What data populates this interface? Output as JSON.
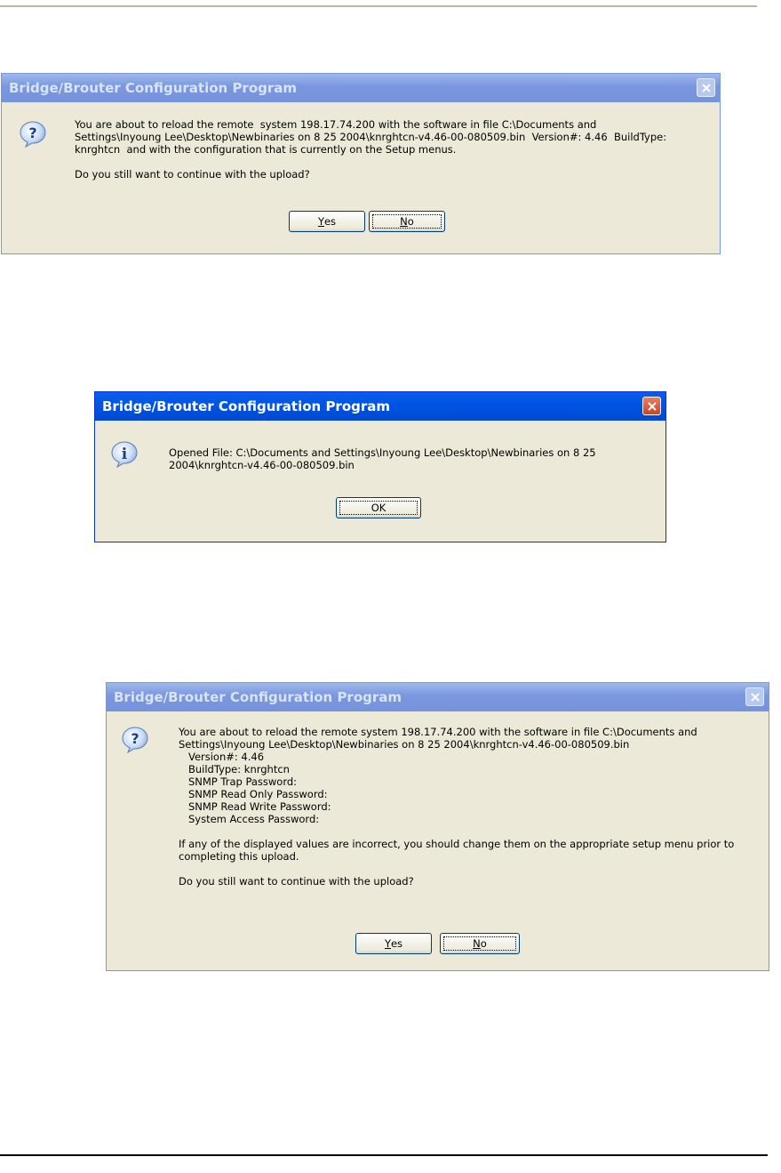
{
  "dialogs": [
    {
      "title": "Bridge/Brouter Configuration Program",
      "icon": "question-icon",
      "message": "You are about to reload the remote  system 198.17.74.200 with the software in file C:\\Documents and\nSettings\\Inyoung Lee\\Desktop\\Newbinaries on 8 25 2004\\knrghtcn-v4.46-00-080509.bin  Version#: 4.46  BuildType:\nknrghtcn  and with the configuration that is currently on the Setup menus.\n\nDo you still want to continue with the upload?",
      "buttons": {
        "yes": {
          "mnemonic": "Y",
          "rest": "es"
        },
        "no": {
          "mnemonic": "N",
          "rest": "o"
        }
      }
    },
    {
      "title": "Bridge/Brouter Configuration Program",
      "icon": "info-icon",
      "message": "Opened File: C:\\Documents and Settings\\Inyoung Lee\\Desktop\\Newbinaries on 8 25\n2004\\knrghtcn-v4.46-00-080509.bin",
      "buttons": {
        "ok": "OK"
      }
    },
    {
      "title": "Bridge/Brouter Configuration Program",
      "icon": "question-icon",
      "message": "You are about to reload the remote system 198.17.74.200 with the software in file C:\\Documents and\nSettings\\Inyoung Lee\\Desktop\\Newbinaries on 8 25 2004\\knrghtcn-v4.46-00-080509.bin\n   Version#: 4.46\n   BuildType: knrghtcn\n   SNMP Trap Password:\n   SNMP Read Only Password:\n   SNMP Read Write Password:\n   System Access Password:\n\nIf any of the displayed values are incorrect, you should change them on the appropriate setup menu prior to\ncompleting this upload.\n\nDo you still want to continue with the upload?",
      "buttons": {
        "yes": {
          "mnemonic": "Y",
          "rest": "es"
        },
        "no": {
          "mnemonic": "N",
          "rest": "o"
        }
      }
    }
  ],
  "colors": {
    "dialog_bg": "#ece9d8",
    "active_title": "#0055e5",
    "inactive_title": "#7a96df",
    "close_active": "#c94520"
  }
}
